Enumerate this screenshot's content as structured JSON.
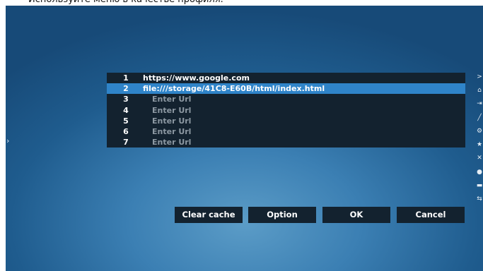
{
  "caption": "Используйте меню в качестве профиля.",
  "url_list": [
    {
      "num": "1",
      "url": "https://www.google.com",
      "placeholder": false
    },
    {
      "num": "2",
      "url": "file:///storage/41C8-E60B/html/index.html",
      "placeholder": false
    },
    {
      "num": "3",
      "url": "Enter Url",
      "placeholder": true
    },
    {
      "num": "4",
      "url": "Enter Url",
      "placeholder": true
    },
    {
      "num": "5",
      "url": "Enter Url",
      "placeholder": true
    },
    {
      "num": "6",
      "url": "Enter Url",
      "placeholder": true
    },
    {
      "num": "7",
      "url": "Enter Url",
      "placeholder": true
    }
  ],
  "buttons": {
    "clear_cache": "Clear cache",
    "option": "Option",
    "ok": "OK",
    "cancel": "Cancel"
  },
  "icons": {
    "left_arrow": "chevron-right-icon",
    "side_toolbar": [
      "chevron-right-icon",
      "home-icon",
      "input-icon",
      "pen-icon",
      "gear-icon",
      "star-icon",
      "tools-icon",
      "info-icon",
      "usb-icon",
      "swap-icon"
    ]
  },
  "colors": {
    "panel": "#13222f",
    "selected_row": "#2f84c9",
    "placeholder_text": "#8c98a2"
  }
}
